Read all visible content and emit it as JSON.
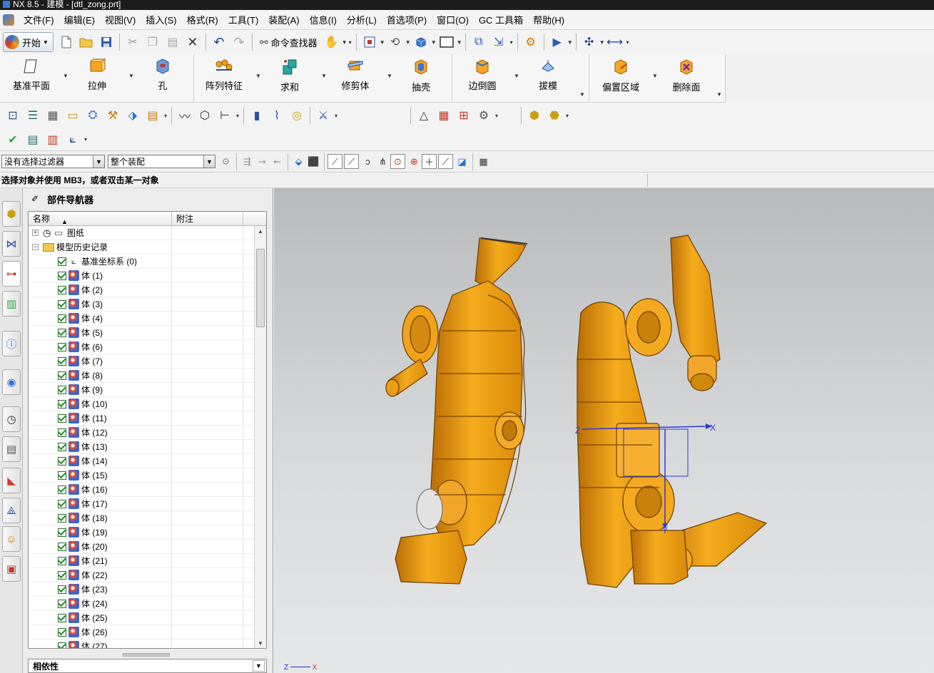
{
  "window": {
    "title": "NX 8.5 - 建模 - [dtl_zong.prt]"
  },
  "menu": [
    "文件(F)",
    "编辑(E)",
    "视图(V)",
    "插入(S)",
    "格式(R)",
    "工具(T)",
    "装配(A)",
    "信息(I)",
    "分析(L)",
    "首选项(P)",
    "窗口(O)",
    "GC 工具箱",
    "帮助(H)"
  ],
  "toolbar": {
    "start_label": "开始",
    "command_finder_label": "命令查找器"
  },
  "ribbon": {
    "features": [
      "基准平面",
      "拉伸",
      "孔",
      "阵列特征",
      "求和",
      "修剪体",
      "抽壳",
      "边倒圆",
      "拔模",
      "偏置区域",
      "删除面"
    ]
  },
  "selection": {
    "filter_value": "没有选择过滤器",
    "scope_value": "整个装配"
  },
  "status": {
    "cue_line": "选择对象并使用 MB3，或者双击某一对象"
  },
  "navigator": {
    "title": "部件导航器",
    "columns": {
      "name": "名称",
      "note": "附注"
    },
    "drawings_label": "图纸",
    "history_label": "模型历史记录",
    "datum_label": "基准坐标系 (0)",
    "bodies": [
      "体 (1)",
      "体 (2)",
      "体 (3)",
      "体 (4)",
      "体 (5)",
      "体 (6)",
      "体 (7)",
      "体 (8)",
      "体 (9)",
      "体 (10)",
      "体 (11)",
      "体 (12)",
      "体 (13)",
      "体 (14)",
      "体 (15)",
      "体 (16)",
      "体 (17)",
      "体 (18)",
      "体 (19)",
      "体 (20)",
      "体 (21)",
      "体 (22)",
      "体 (23)",
      "体 (24)",
      "体 (25)",
      "体 (26)",
      "体 (27)"
    ],
    "dependency_label": "相依性"
  },
  "viewport": {
    "axis_x": "X",
    "axis_y": "Y",
    "axis_z": "Z",
    "model_color": "#f2a417",
    "csys_color": "#2d3ad4"
  }
}
